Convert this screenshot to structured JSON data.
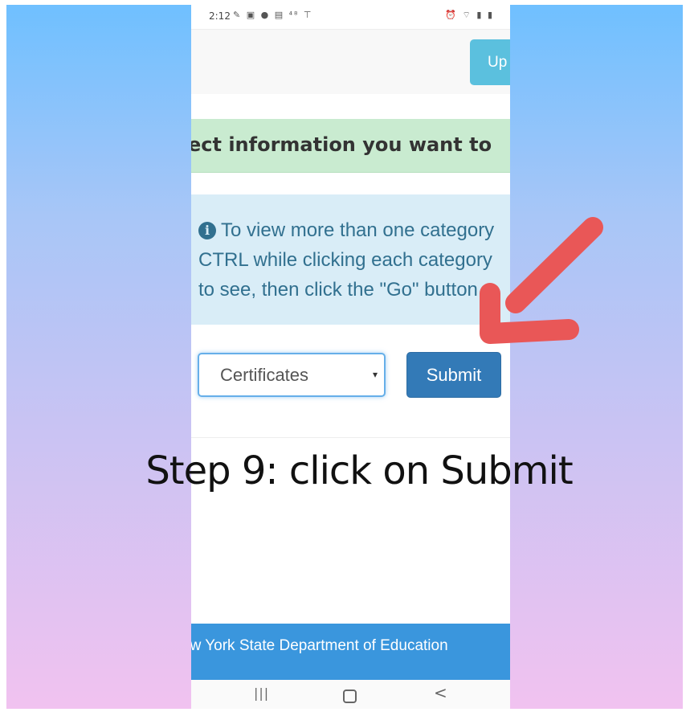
{
  "status_bar": {
    "time": "2:12",
    "left_icons": "✎ ▣ ● ▤ ⁴⁸ ⊤",
    "right_icons": "⏰ ⌔ ▮ ▮"
  },
  "header": {
    "update_button_label": "Up"
  },
  "success_banner": {
    "text": "ect information you want to"
  },
  "info_box": {
    "icon": "i",
    "line1": "To view more than one category",
    "line2": "CTRL while clicking each category",
    "line3": "to see, then click the \"Go\" button."
  },
  "form": {
    "select_value": "Certificates",
    "select_arrow": "▾",
    "submit_label": "Submit"
  },
  "caption": "Step 9: click on Submit",
  "footer": {
    "text": "ew York State Department of Education"
  },
  "nav_bar": {
    "recents": "|||",
    "back": "<"
  },
  "colors": {
    "submit_blue": "#337ab7",
    "info_bg": "#d9edf7",
    "success_bg": "#c9ebd0",
    "footer_blue": "#3a96dd",
    "annotation_arrow": "#e95757"
  }
}
